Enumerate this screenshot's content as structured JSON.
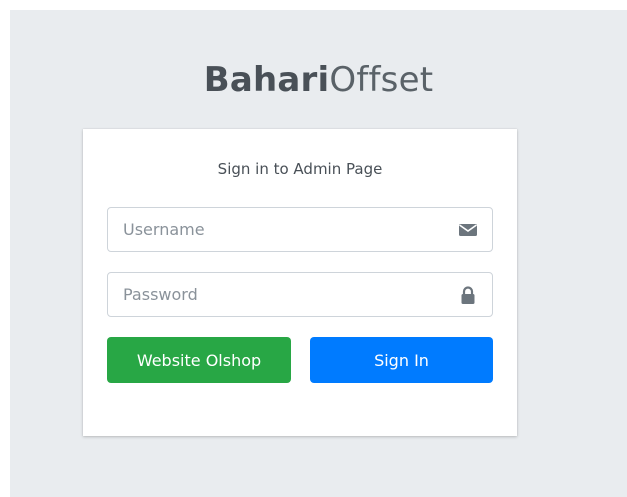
{
  "brand": {
    "bold": "Bahari",
    "light": "Offset"
  },
  "card": {
    "title": "Sign in to Admin Page"
  },
  "username": {
    "placeholder": "Username",
    "value": "",
    "icon": "envelope-icon"
  },
  "password": {
    "placeholder": "Password",
    "value": "",
    "icon": "lock-icon"
  },
  "buttons": {
    "website_label": "Website Olshop",
    "signin_label": "Sign In"
  },
  "colors": {
    "background": "#e9ecef",
    "success": "#28a745",
    "primary": "#007bff",
    "icon": "#6c757d"
  }
}
